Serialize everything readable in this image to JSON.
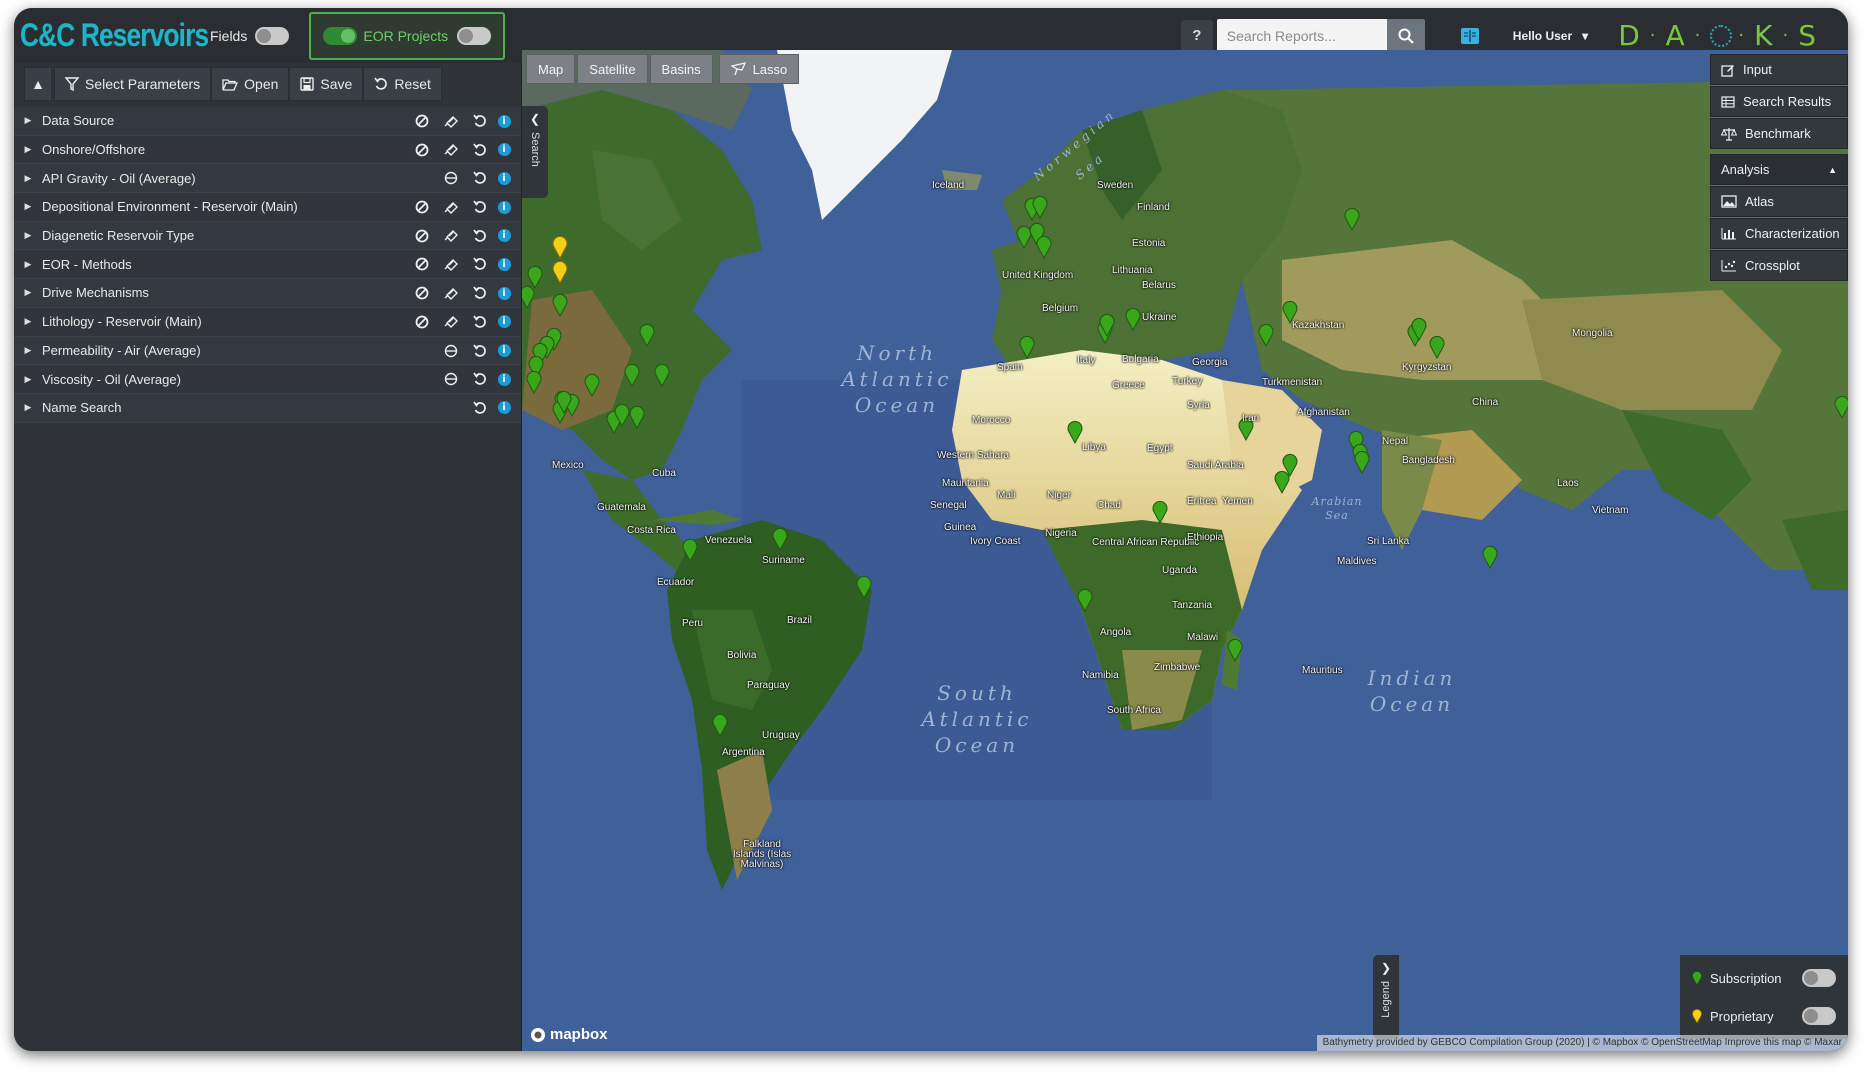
{
  "app": {
    "logo": "C&C Reservoirs"
  },
  "topbar": {
    "fields_label": "Fields",
    "eor_label": "EOR Projects",
    "help_label": "?",
    "search_placeholder": "Search Reports...",
    "user_label": "Hello User",
    "brand": [
      "D",
      "A",
      "K",
      "S"
    ]
  },
  "toolbar": {
    "select_parameters": "Select Parameters",
    "open": "Open",
    "save": "Save",
    "reset": "Reset"
  },
  "parameters": [
    {
      "label": "Data Source"
    },
    {
      "label": "Onshore/Offshore"
    },
    {
      "label": "API Gravity - Oil (Average)"
    },
    {
      "label": "Depositional Environment - Reservoir (Main)"
    },
    {
      "label": "Diagenetic Reservoir Type"
    },
    {
      "label": "EOR - Methods"
    },
    {
      "label": "Drive Mechanisms"
    },
    {
      "label": "Lithology - Reservoir (Main)"
    },
    {
      "label": "Permeability - Air (Average)"
    },
    {
      "label": "Viscosity - Oil (Average)"
    },
    {
      "label": "Name Search"
    }
  ],
  "map": {
    "tabs": [
      "Map",
      "Satellite",
      "Basins"
    ],
    "lasso": "Lasso",
    "search_handle": "Search",
    "oceans": {
      "north_atlantic": "North Atlantic Ocean",
      "south_atlantic": "South Atlantic Ocean",
      "indian": "Indian Ocean",
      "norwegian_sea": "Norwegian Sea",
      "arabian_sea": "Arabian Sea"
    },
    "places": {
      "iceland": "Iceland",
      "sweden": "Sweden",
      "finland": "Finland",
      "estonia": "Estonia",
      "lithuania": "Lithuania",
      "uk": "United Kingdom",
      "belarus": "Belarus",
      "belgium": "Belgium",
      "ukraine": "Ukraine",
      "kazakhstan": "Kazakhstan",
      "mongolia": "Mongolia",
      "spain": "Spain",
      "italy": "Italy",
      "bulgaria": "Bulgaria",
      "georgia": "Georgia",
      "turkmenistan": "Turkmenistan",
      "kyrgyzstan": "Kyrgyzstan",
      "greece": "Greece",
      "turkey": "Turkey",
      "syria": "Syria",
      "afghanistan": "Afghanistan",
      "china": "China",
      "morocco": "Morocco",
      "iran": "Iran",
      "nepal": "Nepal",
      "libya": "Libya",
      "egypt": "Egypt",
      "western_sahara": "Western Sahara",
      "saudi": "Saudi Arabia",
      "bangladesh": "Bangladesh",
      "mauritania": "Mauritania",
      "mali": "Mali",
      "niger": "Niger",
      "chad": "Chad",
      "eritrea": "Eritrea",
      "yemen": "Yemen",
      "laos": "Laos",
      "senegal": "Senegal",
      "guinea": "Guinea",
      "nigeria": "Nigeria",
      "vietnam": "Vietnam",
      "ivory": "Ivory Coast",
      "car": "Central African Republic",
      "ethiopia": "Ethiopia",
      "sri_lanka": "Sri Lanka",
      "maldives": "Maldives",
      "uganda": "Uganda",
      "tanzania": "Tanzania",
      "angola": "Angola",
      "malawi": "Malawi",
      "namibia": "Namibia",
      "zimbabwe": "Zimbabwe",
      "mauritius": "Mauritius",
      "south_africa": "South Africa",
      "mexico": "Mexico",
      "cuba": "Cuba",
      "guatemala": "Guatemala",
      "costa_rica": "Costa Rica",
      "venezuela": "Venezuela",
      "suriname": "Suriname",
      "ecuador": "Ecuador",
      "peru": "Peru",
      "brazil": "Brazil",
      "bolivia": "Bolivia",
      "paraguay": "Paraguay",
      "uruguay": "Uruguay",
      "argentina": "Argentina",
      "falklands": "Falkland Islands (Islas Malvinas)"
    },
    "mapbox_label": "mapbox",
    "attribution": "Bathymetry provided by GEBCO Compilation Group (2020) | © Mapbox © OpenStreetMap Improve this map © Maxar"
  },
  "right_menu": {
    "input": "Input",
    "search_results": "Search Results",
    "benchmark": "Benchmark",
    "analysis": "Analysis",
    "atlas": "Atlas",
    "characterization": "Characterization",
    "crossplot": "Crossplot"
  },
  "legend": {
    "handle": "Legend",
    "subscription": "Subscription",
    "proprietary": "Proprietary"
  },
  "colors": {
    "accent_teal": "#1fb5c8",
    "accent_green": "#4caf50",
    "pin_subscription": "#3aa61c",
    "pin_proprietary": "#f2cf1a",
    "info_blue": "#1d9bd7"
  }
}
